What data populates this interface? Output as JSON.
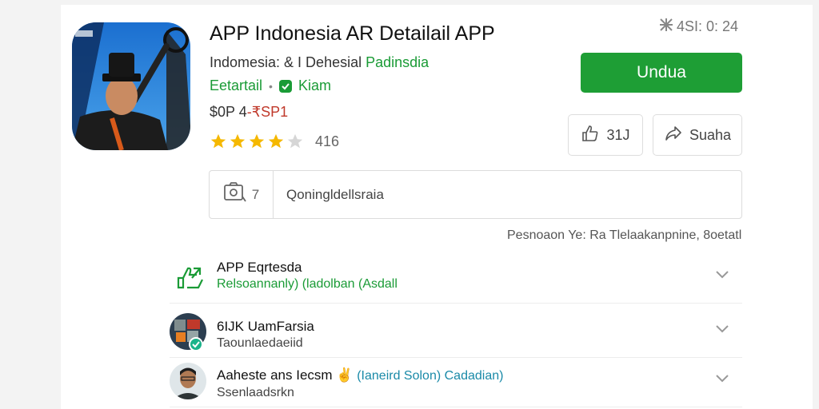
{
  "app": {
    "title": "APP Indonesia AR Detailail APP",
    "developer": "Indomesia: & I Dehesial",
    "developer_tag": "Padinsdia",
    "category": "Eetartail",
    "category_separator": "•",
    "category_tag": "Kiam",
    "price_original": "$0P 4",
    "price_sale": "-₹SP1",
    "rating_value": "416",
    "rating_stars": 4,
    "icon": "app-logo-man-with-top-hat"
  },
  "status": {
    "icon": "settings-icon",
    "text": "4SI: 0: 24"
  },
  "actions": {
    "download_label": "Undua",
    "like_count": "31J",
    "share_label": "Suaha"
  },
  "review": {
    "icon_count": "7",
    "placeholder": "Qoningldellsraia"
  },
  "footnote": "Pesnoaon Ye: Ra  Tlelaakanpnine, 8oetatl",
  "list": [
    {
      "title": "APP Eqrtesda",
      "subtitle": "Relsoannanly) (ladolban (Asdall",
      "icon": "upload-arrow-icon"
    },
    {
      "title": "6IJK UamFarsia",
      "subtitle": "Taounlaedaeiid",
      "icon": "avatar-app-collage"
    },
    {
      "title": "Aaheste ans Iecsm",
      "title_emoji": "✌",
      "title_tag": "(Ianeird Solon) Cadadian)",
      "subtitle": "Ssenlaadsrkn",
      "icon": "avatar-man"
    }
  ],
  "colors": {
    "accent_green": "#1e9e35",
    "sale_red": "#c0392b",
    "star_gold": "#f5b800",
    "link_teal": "#1a8aa8"
  }
}
